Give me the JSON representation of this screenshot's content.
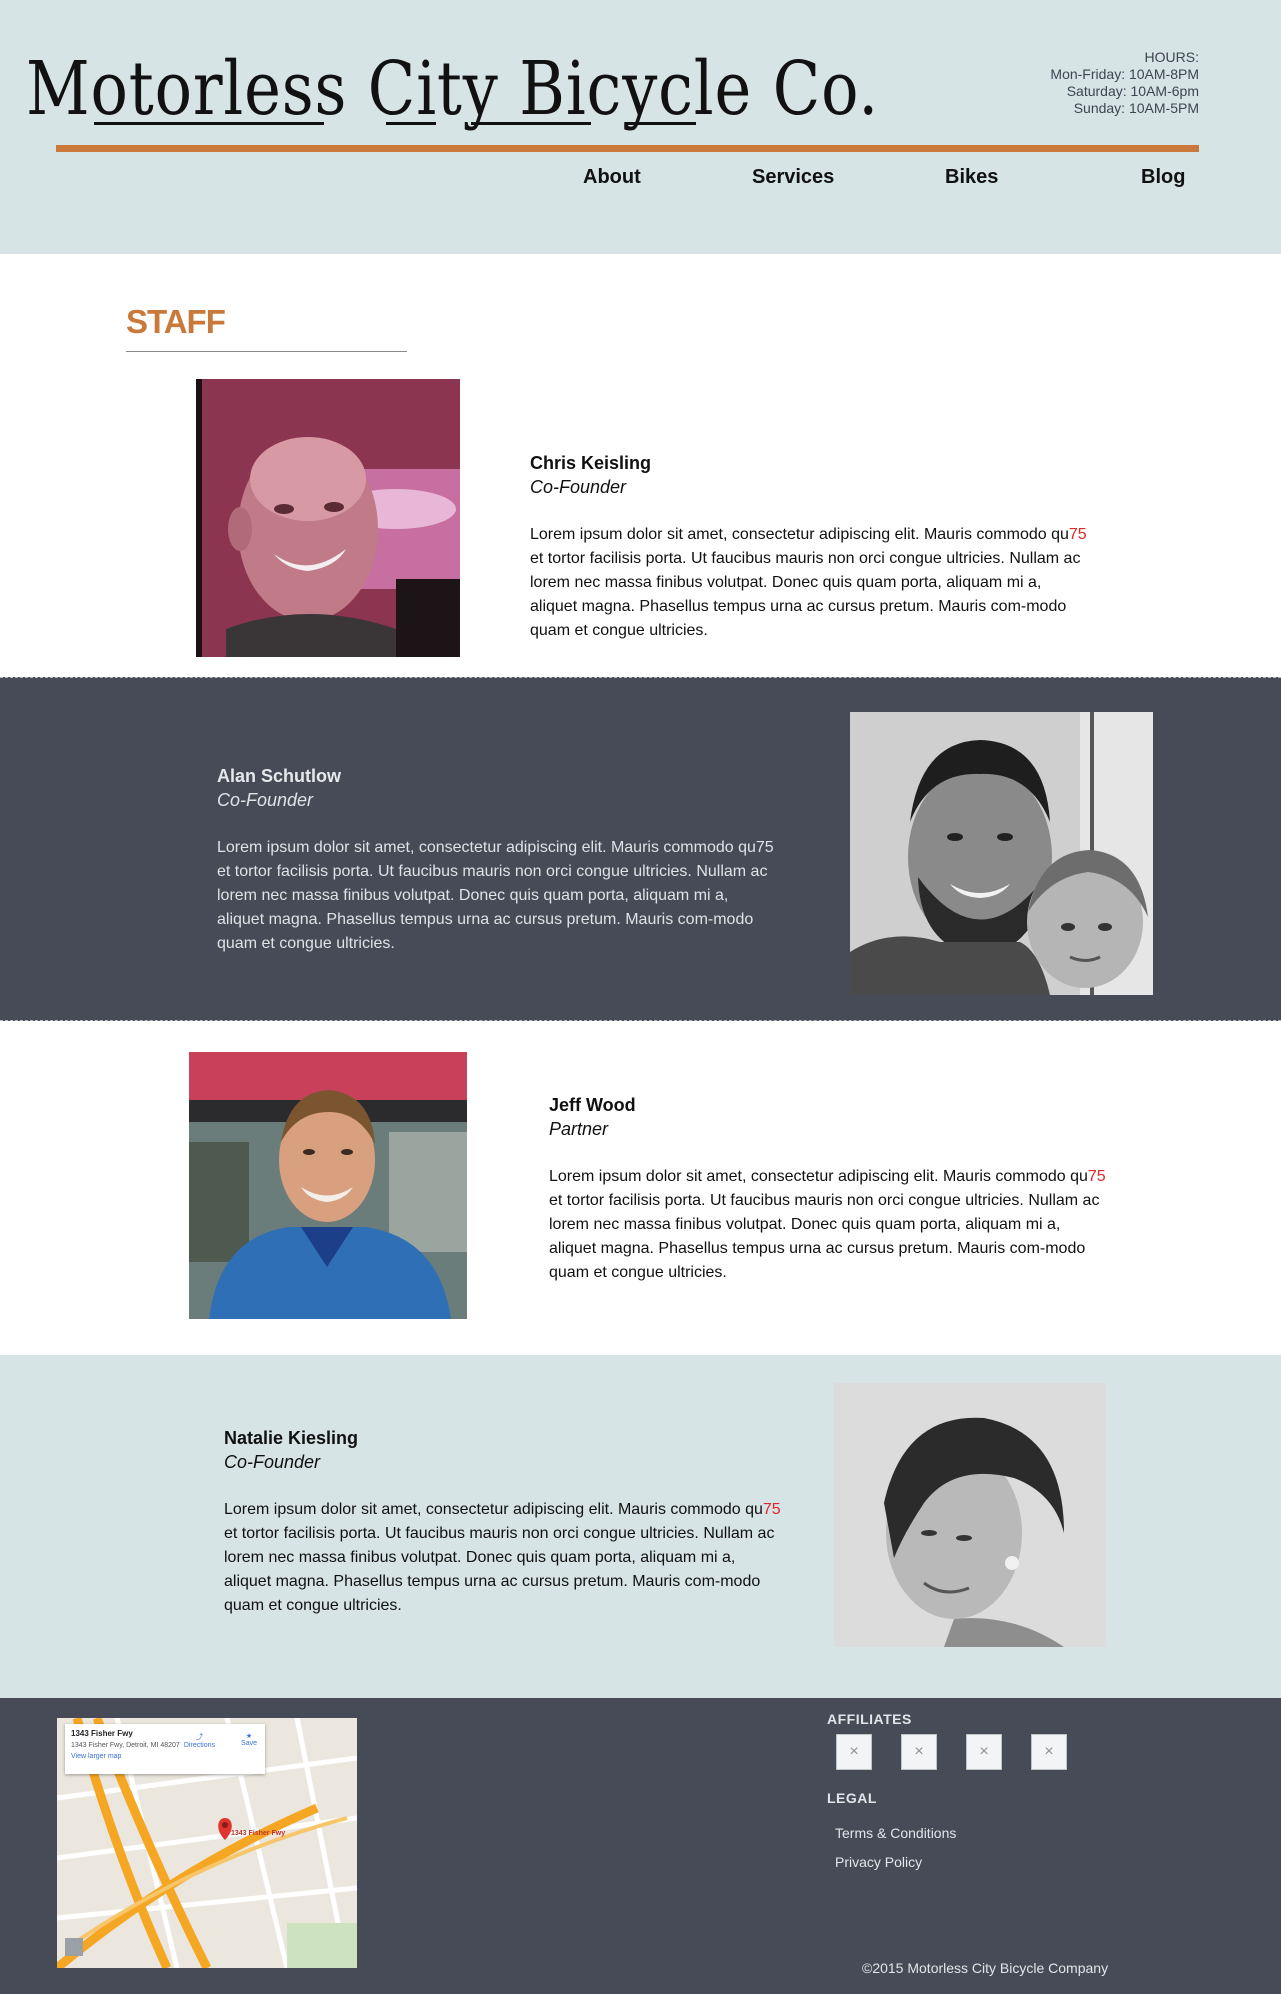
{
  "header": {
    "logo_text": "Motorless City Bicycle Co.",
    "hours": {
      "label": "HOURS:",
      "weekday": "Mon-Friday: 10AM-8PM",
      "saturday": "Saturday: 10AM-6pm",
      "sunday": "Sunday: 10AM-5PM"
    },
    "nav": [
      "About",
      "Services",
      "Bikes",
      "Blog"
    ]
  },
  "staff": {
    "title": "STAFF",
    "members": [
      {
        "name": "Chris Keisling",
        "role": "Co-Founder",
        "bio_a": "Lorem ipsum dolor sit amet, consectetur adipiscing elit. Mauris commodo qu",
        "bio_hl": "75",
        "bio_b": " et tortor facilisis porta. Ut faucibus mauris non orci congue ultricies. Nullam ac lorem nec massa finibus volutpat. Donec quis quam porta, aliquam mi a, aliquet magna. Phasellus tempus urna ac cursus pretum. Mauris com-modo quam et congue ultricies."
      },
      {
        "name": "Alan Schutlow",
        "role": "Co-Founder",
        "bio_a": "Lorem ipsum dolor sit amet, consectetur adipiscing elit. Mauris commodo qu",
        "bio_hl": "75",
        "bio_b": " et tortor facilisis porta. Ut faucibus mauris non orci congue ultricies. Nullam ac lorem nec massa finibus volutpat. Donec quis quam porta, aliquam mi a, aliquet magna. Phasellus tempus urna ac cursus pretum. Mauris com-modo quam et congue ultricies."
      },
      {
        "name": "Jeff Wood",
        "role": "Partner",
        "bio_a": "Lorem ipsum dolor sit amet, consectetur adipiscing elit. Mauris commodo qu",
        "bio_hl": "75",
        "bio_b": " et tortor facilisis porta. Ut faucibus mauris non orci congue ultricies. Nullam ac lorem nec massa finibus volutpat. Donec quis quam porta, aliquam mi a, aliquet magna. Phasellus tempus urna ac cursus pretum. Mauris com-modo quam et congue ultricies."
      },
      {
        "name": "Natalie Kiesling",
        "role": "Co-Founder",
        "bio_a": "Lorem ipsum dolor sit amet, consectetur adipiscing elit. Mauris commodo qu",
        "bio_hl": "75",
        "bio_b": " et tortor facilisis porta. Ut faucibus mauris non orci congue ultricies. Nullam ac lorem nec massa finibus volutpat. Donec quis quam porta, aliquam mi a, aliquet magna. Phasellus tempus urna ac cursus pretum. Mauris com-modo quam et congue ultricies."
      }
    ]
  },
  "footer": {
    "map": {
      "title": "1343 Fisher Fwy",
      "address": "1343 Fisher Fwy, Detroit, MI 48207",
      "larger_map": "View larger map",
      "directions": "Directions",
      "save": "Save",
      "pin_label": "1343 Fisher Fwy"
    },
    "affiliates_heading": "AFFILIATES",
    "affiliate_placeholder": "×",
    "legal_heading": "LEGAL",
    "legal_links": [
      "Terms & Conditions",
      "Privacy Policy"
    ],
    "copyright": "©2015 Motorless City Bicycle Company"
  },
  "colors": {
    "header_bg": "#d6e4e5",
    "accent_orange": "#c97a3a",
    "dark_band": "#464b57",
    "highlight_red": "#e0262b"
  }
}
